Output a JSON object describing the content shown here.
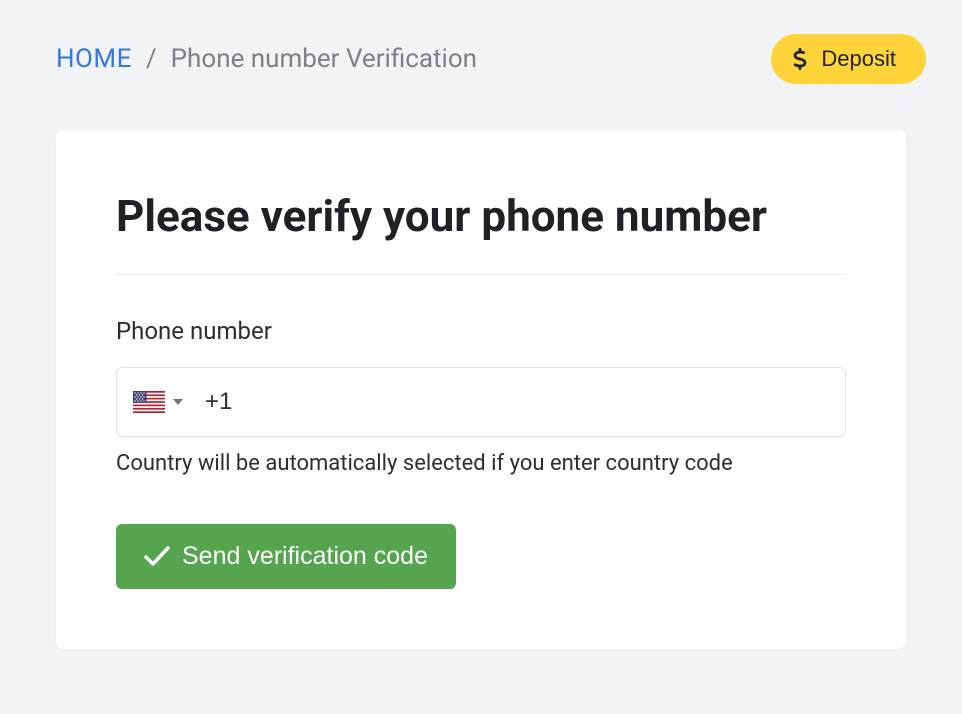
{
  "breadcrumb": {
    "home": "HOME",
    "separator": "/",
    "current": "Phone number Verification"
  },
  "header": {
    "deposit_label": "Deposit"
  },
  "card": {
    "title": "Please verify your phone number",
    "phone_label": "Phone number",
    "country_code_value": "+1",
    "selected_country": "US",
    "hint": "Country will be automatically selected if you enter country code",
    "send_button": "Send verification code"
  },
  "colors": {
    "accent_yellow": "#ffd43b",
    "accent_green": "#55a44e",
    "link_blue": "#3277e6",
    "bg": "#f1f3f5",
    "card_bg": "#ffffff"
  },
  "icons": {
    "dollar": "dollar-icon",
    "flag_us": "flag-us-icon",
    "caret_down": "caret-down-icon",
    "check": "check-icon"
  }
}
